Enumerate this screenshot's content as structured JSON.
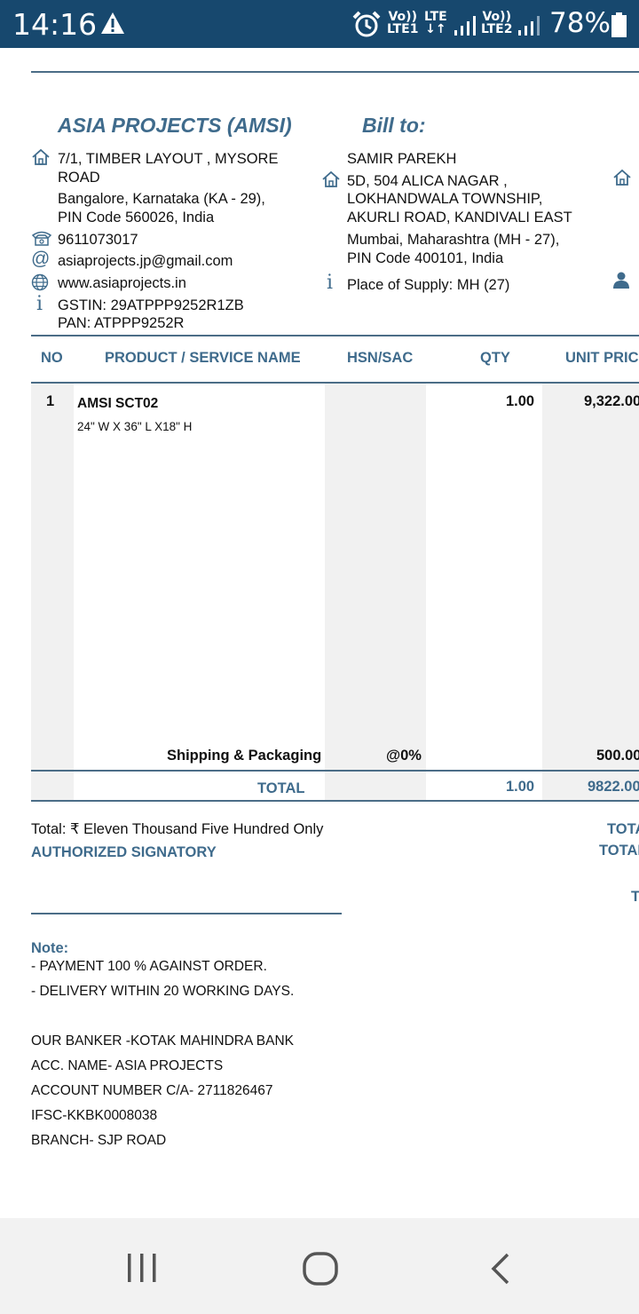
{
  "status_bar": {
    "time": "14:16",
    "sim1_top": "Vo))",
    "sim1_bottom": "LTE1",
    "lte_top": "LTE",
    "lte_bottom": "↓↑",
    "sim2_top": "Vo))",
    "sim2_bottom": "LTE2",
    "battery": "78%",
    "icons": [
      "warning-icon",
      "alarm-icon",
      "signal-icon",
      "battery-icon"
    ]
  },
  "seller": {
    "name": "ASIA PROJECTS (AMSI)",
    "address_line1": "7/1, TIMBER LAYOUT , MYSORE",
    "address_line2": "ROAD",
    "address_line3": "Bangalore, Karnataka (KA - 29),",
    "address_line4": "PIN Code 560026, India",
    "phone": "9611073017",
    "email": "asiaprojects.jp@gmail.com",
    "website": "www.asiaprojects.in",
    "gstin": "GSTIN: 29ATPPP9252R1ZB",
    "pan": "PAN: ATPPP9252R"
  },
  "bill_to": {
    "heading": "Bill to:",
    "name": "SAMIR PAREKH",
    "address_line1": "5D, 504 ALICA NAGAR ,",
    "address_line2": "LOKHANDWALA TOWNSHIP,",
    "address_line3": "AKURLI ROAD, KANDIVALI EAST",
    "address_line4": "Mumbai, Maharashtra (MH - 27),",
    "address_line5": "PIN Code 400101, India",
    "place_of_supply": "Place of Supply: MH (27)"
  },
  "table": {
    "headers": [
      "NO",
      "PRODUCT / SERVICE NAME",
      "HSN/SAC",
      "QTY",
      "UNIT PRIC"
    ],
    "rows": [
      {
        "no": "1",
        "name": "AMSI SCT02",
        "description": "24\" W X 36\" L X18\" H",
        "hsn": "",
        "qty": "1.00",
        "unit_price": "9,322.00"
      }
    ],
    "shipping": {
      "label": "Shipping & Packaging",
      "rate": "@0%",
      "amount": "500.00"
    },
    "total": {
      "label": "TOTAL",
      "qty": "1.00",
      "amount": "9822.00"
    }
  },
  "footer": {
    "total_words_label": "Total:",
    "currency_symbol": "₹",
    "total_words": "Eleven Thousand Five Hundred Only",
    "authorized": "AUTHORIZED SIGNATORY",
    "right_label1": "TOTA",
    "right_label2": "TOTAL",
    "right_label3": "T"
  },
  "note": {
    "heading": "Note:",
    "lines": [
      "- PAYMENT 100 % AGAINST ORDER.",
      "- DELIVERY WITHIN 20 WORKING DAYS.",
      "",
      "OUR BANKER -KOTAK MAHINDRA BANK",
      "ACC. NAME- ASIA PROJECTS",
      "ACCOUNT NUMBER C/A- 2711826467",
      "IFSC-KKBK0008038",
      "BRANCH- SJP ROAD"
    ]
  },
  "colors": {
    "status_bar": "#17486e",
    "accent": "#3f6b8c",
    "rule": "#4b6d87"
  }
}
